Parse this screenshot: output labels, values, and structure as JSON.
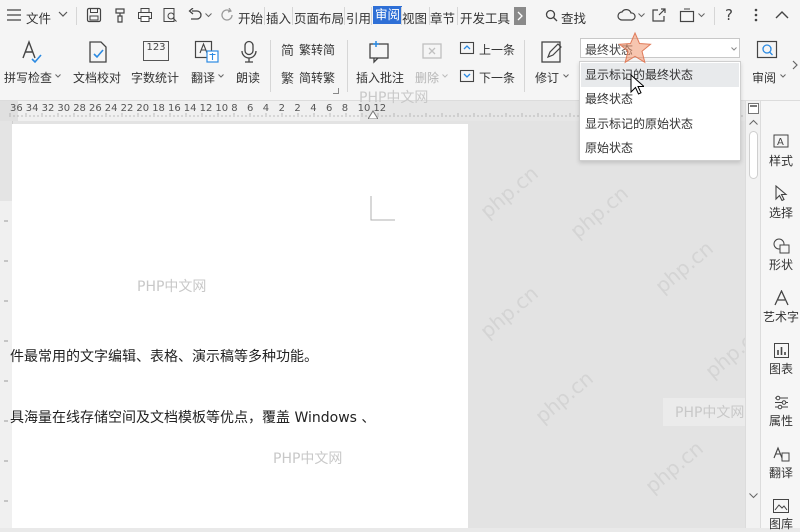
{
  "menubar": {
    "file_menu": "文件",
    "tabs": [
      "开始",
      "插入",
      "页面布局",
      "引用",
      "审阅",
      "视图",
      "章节",
      "开发工具"
    ],
    "active_tab": "审阅",
    "search_label": "查找",
    "colors": {
      "active_tab_bg": "#2e6fd6"
    }
  },
  "ribbon": {
    "spell_check": "拼写检查",
    "doc_proof": "文档校对",
    "word_count": "字数统计",
    "word_count_icon_text": "123",
    "translate": "翻译",
    "read_aloud": "朗读",
    "trad_to_simp": "繁转简",
    "simp_to_trad": "简转繁",
    "insert_comment": "插入批注",
    "delete": "删除",
    "prev_item": "上一条",
    "next_item": "下一条",
    "revise": "修订",
    "review": "审阅"
  },
  "combo": {
    "value": "最终状态"
  },
  "dropdown": {
    "items": [
      "显示标记的最终状态",
      "最终状态",
      "显示标记的原始状态",
      "原始状态"
    ],
    "highlighted_index": 0
  },
  "ruler": {
    "numbers": [
      "36",
      "34",
      "32",
      "30",
      "28",
      "26",
      "24",
      "22",
      "20",
      "18",
      "16",
      "14",
      "12",
      "10",
      "8",
      "6",
      "4",
      "2",
      "2",
      "4",
      "6",
      "8",
      "10",
      "12"
    ]
  },
  "document": {
    "line1": "件最常用的文字编辑、表格、演示稿等多种功能。",
    "line2": "具海量在线存储空间及文档模板等优点，覆盖 Windows 、"
  },
  "watermarks": {
    "php_cn": "PHP中文网",
    "php_site": "php.cn"
  },
  "right_panel": {
    "items": [
      "样式",
      "选择",
      "形状",
      "艺术字",
      "图表",
      "属性",
      "翻译",
      "图库"
    ]
  }
}
